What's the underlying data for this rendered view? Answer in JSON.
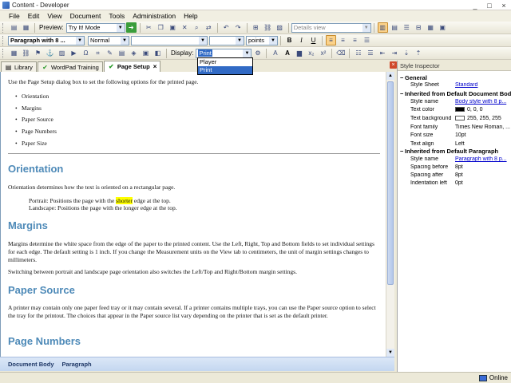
{
  "window": {
    "title": "Content - Developer",
    "controls": [
      "_",
      "□",
      "×"
    ]
  },
  "menu": [
    "File",
    "Edit",
    "View",
    "Document",
    "Tools",
    "Administration",
    "Help"
  ],
  "toolbar1": {
    "preview_label": "Preview:",
    "preview_value": "Try It! Mode",
    "view_value": "Details view"
  },
  "toolbar2": {
    "paragraph_style": "Paragraph with 8 ...",
    "font_weight": "Normal",
    "font_name": "",
    "font_size": "",
    "units": "points"
  },
  "toolbar3": {
    "display_label": "Display:",
    "display_value": "Print",
    "display_options": [
      "Player",
      "Print"
    ]
  },
  "tabs": [
    {
      "label": "Library",
      "icon": "library-icon"
    },
    {
      "label": "WordPad Training",
      "icon": "check-icon"
    },
    {
      "label": "Page Setup",
      "icon": "check-icon",
      "active": true
    }
  ],
  "document": {
    "intro": "Use the Page Setup dialog box to set the following options for the printed page.",
    "bullets": [
      "Orientation",
      "Margins",
      "Paper Source",
      "Page Numbers",
      "Paper Size"
    ],
    "h_orientation": "Orientation",
    "p_orientation": "Orientation determines how the text is oriented on a rectangular page.",
    "portrait_a": "Portrait: Positions the page with the ",
    "portrait_hl": "shorter",
    "portrait_b": " edge at the top.",
    "landscape": "Landscape: Positions the page with the longer edge at the top.",
    "h_margins": "Margins",
    "p_margins1": "Margins determine the white space from the edge of the paper to the printed content. Use the Left, Right, Top and Bottom fields to set individual settings for each edge. The default setting is 1 inch. If you change the Measurement units on the View tab to centimeters, the unit of margin settings changes to millimeters.",
    "p_margins2": "Switching between portrait and landscape page orientation also switches the Left/Top and Right/Bottom margin settings.",
    "h_paper_source": "Paper Source",
    "p_paper_source": "A printer may contain only one paper feed tray or it may contain several. If a printer contains multiple trays, you can use the Paper source option to select the tray for the printout. The choices that appear in the Paper source list vary depending on the printer that is set as the default printer.",
    "h_page_numbers": "Page Numbers"
  },
  "breadcrumb": [
    "Document Body",
    "Paragraph"
  ],
  "inspector": {
    "title": "Style Inspector",
    "groups": {
      "general": "General",
      "doc_body": "Inherited from Default Document Body",
      "paragraph": "Inherited from Default Paragraph"
    },
    "rows": {
      "style_sheet_k": "Style Sheet",
      "style_sheet_v": "Standard",
      "style_name_k": "Style name",
      "style_name_v": "Body style with 8 p...",
      "text_color_k": "Text color",
      "text_color_v": "0, 0, 0",
      "text_bg_k": "Text background c",
      "text_bg_v": "255, 255, 255",
      "font_family_k": "Font family",
      "font_family_v": "Times New Roman, ...",
      "font_size_k": "Font size",
      "font_size_v": "10pt",
      "text_align_k": "Text align",
      "text_align_v": "Left",
      "p_style_name_k": "Style name",
      "p_style_name_v": "Paragraph with 8 p...",
      "space_before_k": "Spacing before",
      "space_before_v": "8pt",
      "space_after_k": "Spacing after",
      "space_after_v": "8pt",
      "indent_left_k": "Indentation left",
      "indent_left_v": "0pt"
    }
  },
  "status": {
    "online": "Online"
  },
  "colors": {
    "heading": "#4e8ab8",
    "highlight": "#ffff00",
    "selection": "#316ac5"
  }
}
